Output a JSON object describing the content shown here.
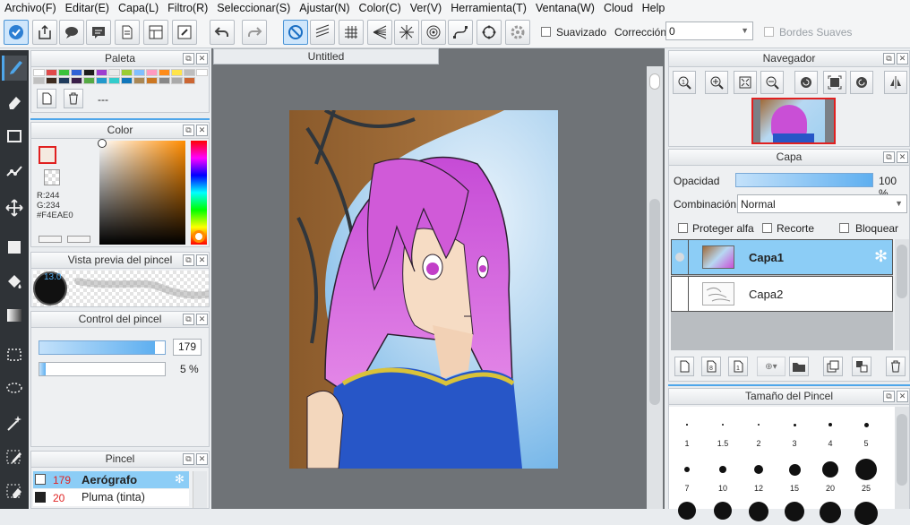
{
  "menu": [
    "Archivo(F)",
    "Editar(E)",
    "Capa(L)",
    "Filtro(R)",
    "Seleccionar(S)",
    "Ajustar(N)",
    "Color(C)",
    "Ver(V)",
    "Herramienta(T)",
    "Ventana(W)",
    "Cloud",
    "Help"
  ],
  "toolbar": {
    "smoothing_label": "Suavizado",
    "correction_label": "Corrección",
    "correction_value": "0",
    "soft_edges_label": "Bordes Suaves"
  },
  "palette": {
    "title": "Paleta",
    "name": "---",
    "swatches": [
      "#ffffff",
      "#e04a4a",
      "#3bc23b",
      "#2f62d6",
      "#1d1d1d",
      "#9e3fd0",
      "#eaeaea",
      "#9acd32",
      "#7fbfff",
      "#ff9ac0",
      "#ff8c1a",
      "#ffe44a",
      "#bdbdbd",
      "#ffffff",
      "#c0c0c0",
      "#3d2b1f",
      "#1f3b5c",
      "#3a1f4a",
      "#55aa44",
      "#2299cc",
      "#33cccc",
      "#1177bb",
      "#aa8855",
      "#cc7722",
      "#888888",
      "#aaaaaa",
      "#cc6633"
    ]
  },
  "color": {
    "title": "Color",
    "r": "R:244",
    "g": "G:234",
    "hex": "#F4EAE0",
    "accent": "#4ea6ea"
  },
  "brush_preview": {
    "title": "Vista previa del pincel",
    "size": "13.0"
  },
  "brush_control": {
    "title": "Control del pincel",
    "size": "179",
    "opacity": "5 %",
    "size_fraction": 0.92,
    "opacity_fraction": 0.05
  },
  "brush": {
    "title": "Pincel",
    "items": [
      {
        "size": "179",
        "name": "Aerógrafo"
      },
      {
        "size": "20",
        "name": "Pluma (tinta)"
      }
    ]
  },
  "document": {
    "tab": "Untitled"
  },
  "navigator": {
    "title": "Navegador"
  },
  "layer": {
    "title": "Capa",
    "opacity_label": "Opacidad",
    "opacity_value": "100 %",
    "opacity_fraction": 1.0,
    "blend_label": "Combinación",
    "blend_value": "Normal",
    "protect_alpha": "Proteger alfa",
    "clipping": "Recorte",
    "lock": "Bloquear",
    "layers": [
      {
        "name": "Capa1",
        "selected": true
      },
      {
        "name": "Capa2",
        "selected": false
      }
    ]
  },
  "brush_size": {
    "title": "Tamaño del Pincel",
    "sizes": [
      "1",
      "1.5",
      "2",
      "3",
      "4",
      "5",
      "7",
      "10",
      "12",
      "15",
      "20",
      "25"
    ]
  }
}
